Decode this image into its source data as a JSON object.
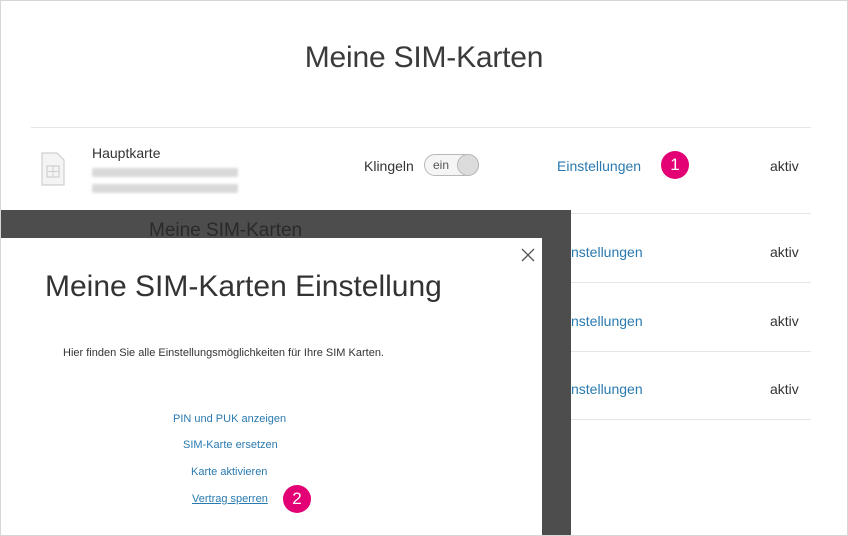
{
  "page": {
    "title": "Meine SIM-Karten"
  },
  "main_sim": {
    "name": "Hauptkarte",
    "ring_label": "Klingeln",
    "toggle_label": "ein",
    "settings_label": "Einstellungen",
    "status": "aktiv"
  },
  "other_rows": [
    {
      "settings_label": "nstellungen",
      "status": "aktiv"
    },
    {
      "settings_label": "nstellungen",
      "status": "aktiv"
    },
    {
      "settings_label": "nstellungen",
      "status": "aktiv"
    }
  ],
  "overlay": {
    "background_title": "Meine SIM-Karten"
  },
  "modal": {
    "title": "Meine SIM-Karten Einstellung",
    "description": "Hier finden Sie alle Einstellungsmöglichkeiten für Ihre SIM Karten.",
    "links": [
      "PIN und PUK anzeigen",
      "SIM-Karte ersetzen",
      "Karte aktivieren",
      "Vertrag sperren"
    ]
  },
  "annotations": {
    "step1": "1",
    "step2": "2"
  },
  "colors": {
    "brand_magenta": "#e20074",
    "link_blue": "#2a7ab0",
    "overlay_gray": "#4d4d4d"
  },
  "icons": {
    "sim": "sim-card-icon",
    "close": "close-icon"
  }
}
